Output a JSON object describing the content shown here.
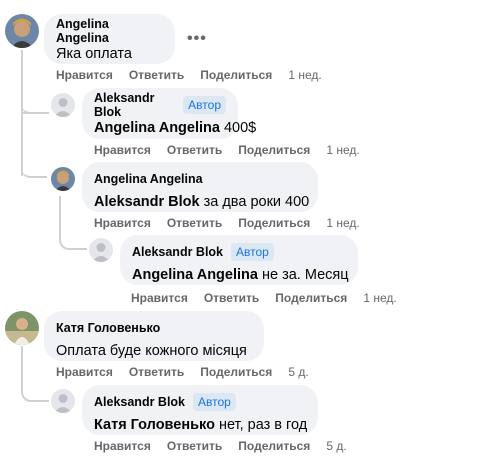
{
  "actions": {
    "like": "Нравится",
    "reply": "Ответить",
    "share": "Поделиться"
  },
  "author_badge": "Автор",
  "comments": [
    {
      "author": "Angelina Angelina",
      "mention": "",
      "text": "Яка оплата",
      "time": "1 нед."
    },
    {
      "author": "Aleksandr Blok",
      "mention": "Angelina Angelina",
      "text": " 400$",
      "time": "1 нед."
    },
    {
      "author": "Angelina Angelina",
      "mention": "Aleksandr Blok",
      "text": " за два роки 400",
      "time": "1 нед."
    },
    {
      "author": "Aleksandr Blok",
      "mention": "Angelina Angelina",
      "text": " не за. Месяц",
      "time": "1 нед."
    },
    {
      "author": "Катя Головенько",
      "mention": "",
      "text": "Оплата буде кожного місяця",
      "time": "5 д."
    },
    {
      "author": "Aleksandr Blok",
      "mention": "Катя Головенько",
      "text": " нет, раз в год",
      "time": "5 д."
    }
  ],
  "more_options_icon": "more-horizontal-icon",
  "colors": {
    "bubble": "#f0f2f5",
    "link_blue": "#1b74e4",
    "muted": "#65676b",
    "thread": "#ced0d4"
  }
}
